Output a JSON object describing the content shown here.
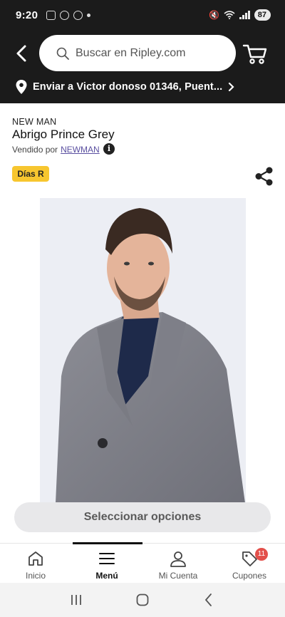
{
  "status_bar": {
    "time": "9:20",
    "battery": "87"
  },
  "header": {
    "search_placeholder": "Buscar en Ripley.com",
    "address": "Enviar a Victor donoso 01346, Puent..."
  },
  "product": {
    "brand": "NEW MAN",
    "name": "Abrigo Prince Grey",
    "seller_prefix": "Vendido por",
    "seller_name": "NEWMAN",
    "badge": "Días R",
    "image_alt": "Hombre con abrigo gris"
  },
  "actions": {
    "select_options": "Seleccionar opciones"
  },
  "bottom_nav": {
    "items": [
      {
        "label": "Inicio",
        "icon": "home-icon"
      },
      {
        "label": "Menú",
        "icon": "menu-icon"
      },
      {
        "label": "Mi Cuenta",
        "icon": "user-icon"
      },
      {
        "label": "Cupones",
        "icon": "coupon-icon"
      }
    ],
    "coupon_count": "11"
  },
  "colors": {
    "header_bg": "#1b1b1b",
    "badge_yellow": "#f7c62f",
    "coupon_red": "#e3504b",
    "seller_link": "#5a4fa0"
  }
}
